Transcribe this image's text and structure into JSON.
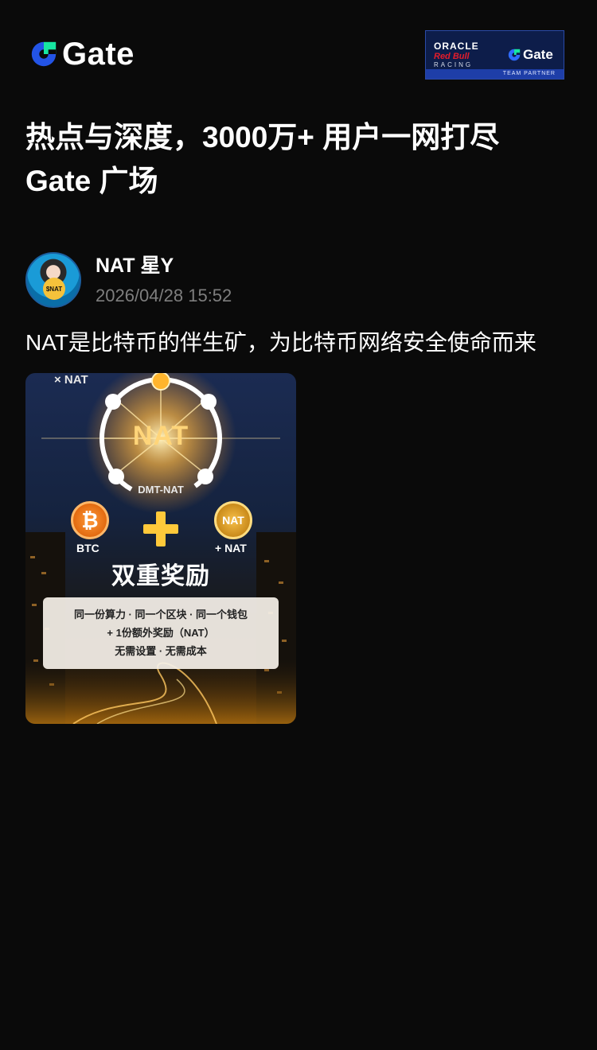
{
  "header": {
    "brand_name": "Gate",
    "partner": {
      "oracle": "ORACLE",
      "redbull": "Red Bull",
      "racing": "RACING",
      "brand": "Gate",
      "strip": "TEAM PARTNER"
    }
  },
  "headline": {
    "line1": "热点与深度，3000万+ 用户一网打尽",
    "line2": "Gate 广场"
  },
  "post": {
    "author_name": "NAT 星Y",
    "avatar_badge": "$NAT",
    "timestamp": "2026/04/28 15:52",
    "text": "NAT是比特币的伴生矿，为比特币网络安全使命而来",
    "image": {
      "corner_tag": "× NAT",
      "center_label": "NAT",
      "subtitle": "DMT-NAT",
      "coin_left_symbol": "₿",
      "coin_left_label": "BTC",
      "coin_right_symbol": "NAT",
      "coin_right_label": "+ NAT",
      "title": "双重奖励",
      "card_line1": "同一份算力 · 同一个区块 · 同一个钱包",
      "card_line2": "+ 1份额外奖励（NAT）",
      "card_line3": "无需设置 · 无需成本"
    }
  },
  "colors": {
    "background": "#0a0a0a",
    "brand_blue": "#2354e6",
    "brand_green": "#17e6a1",
    "muted_text": "#7e7e7e",
    "accent_gold": "#ffc93a"
  }
}
